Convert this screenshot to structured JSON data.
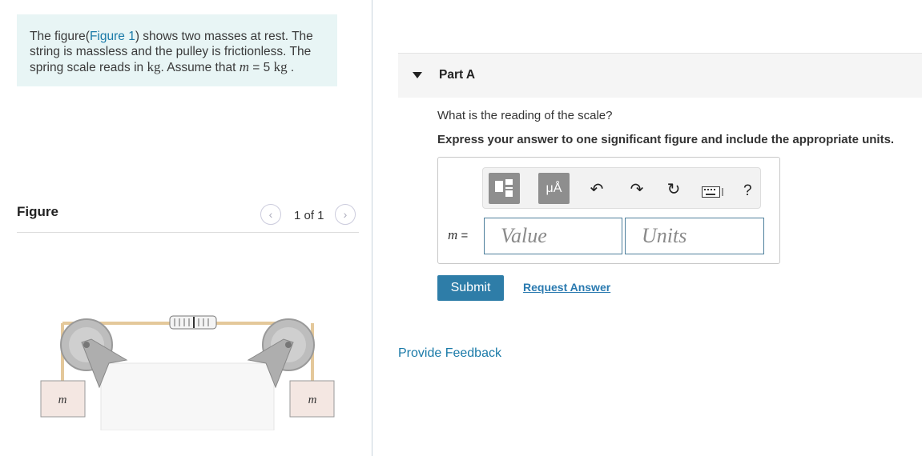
{
  "problem": {
    "intro": "The figure(",
    "figure_link": "Figure 1",
    "text_a": ") shows two masses at rest. The string is massless and the pulley is frictionless. The spring scale reads in ",
    "unit_kg": "kg",
    "text_b": ". Assume that ",
    "m_var": "m",
    "eq": " = 5 ",
    "unit_kg2": "kg",
    "end": " ."
  },
  "figure_panel": {
    "label": "Figure",
    "prev_icon": "chevron-left-icon",
    "next_icon": "chevron-right-icon",
    "count": "1 of 1",
    "mass_left": "m",
    "mass_right": "m"
  },
  "part_a": {
    "title": "Part A",
    "question": "What is the reading of the scale?",
    "instruction": "Express your answer to one significant figure and include the appropriate units.",
    "toolbar": {
      "templates_icon": "templates-icon",
      "units_label": "μÅ",
      "undo_icon": "undo-icon",
      "redo_icon": "redo-icon",
      "reset_icon": "reset-icon",
      "keyboard_icon": "keyboard-icon",
      "help_label": "?"
    },
    "answer_label_var": "m",
    "answer_label_eq": " =",
    "value_placeholder": "Value",
    "units_placeholder": "Units",
    "submit_label": "Submit",
    "request_label": "Request Answer"
  },
  "feedback_label": "Provide Feedback",
  "colors": {
    "accent": "#2e7da8",
    "link": "#1a7aa8",
    "problem_bg": "#e8f5f5",
    "toolbar_btn": "#8e8e8e"
  }
}
